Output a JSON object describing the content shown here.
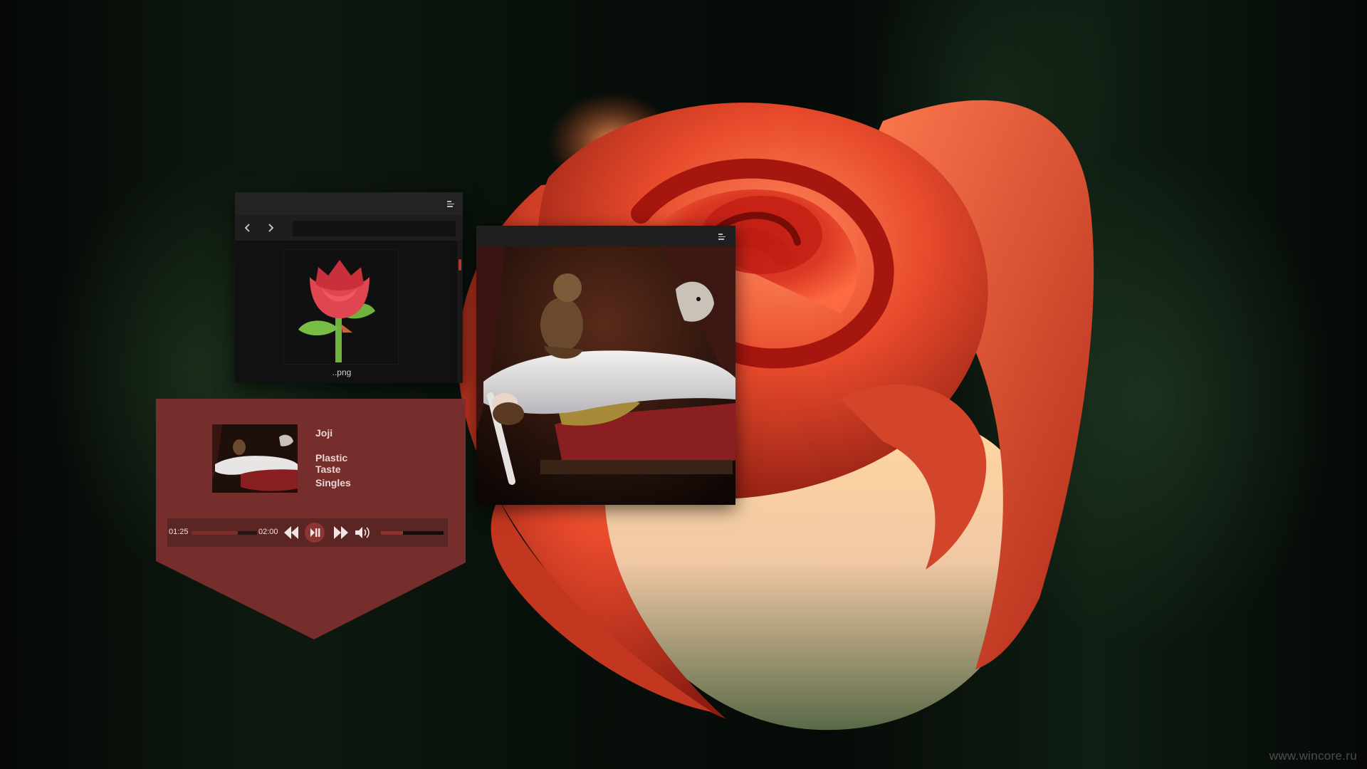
{
  "file_viewer": {
    "path": "",
    "file_name": "..png",
    "icons": {
      "back": "chevron-left-icon",
      "forward": "chevron-right-icon",
      "menu": "menu-icon"
    }
  },
  "image_viewer": {
    "icons": {
      "menu": "menu-icon"
    }
  },
  "player": {
    "artist": "Joji",
    "title": "Plastic Taste",
    "album": "Singles",
    "elapsed": "01:25",
    "total": "02:00",
    "progress": 0.71,
    "volume": 0.35,
    "icons": {
      "rewind": "rewind-icon",
      "play_pause": "play-pause-icon",
      "forward": "fast-forward-icon",
      "volume": "volume-icon"
    }
  },
  "watermark": "www.wincore.ru",
  "colors": {
    "player_bg": "#7a2f2d",
    "control_bar": "#5b2523",
    "accent": "#b33a32",
    "window_bg": "#151515",
    "titlebar": "#232323"
  }
}
